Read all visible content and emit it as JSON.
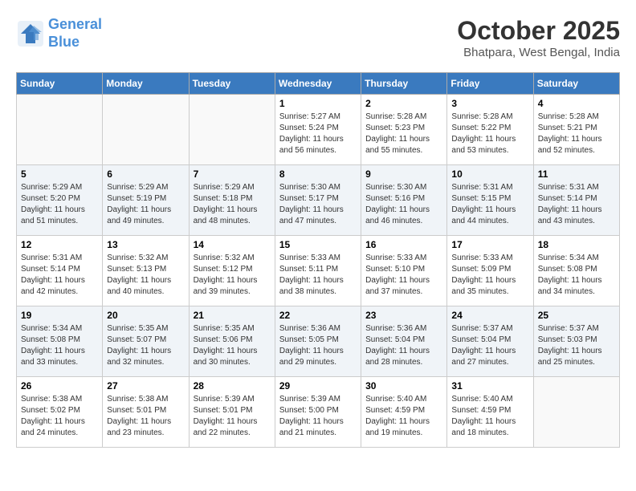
{
  "header": {
    "logo_line1": "General",
    "logo_line2": "Blue",
    "month": "October 2025",
    "location": "Bhatpara, West Bengal, India"
  },
  "days_of_week": [
    "Sunday",
    "Monday",
    "Tuesday",
    "Wednesday",
    "Thursday",
    "Friday",
    "Saturday"
  ],
  "weeks": [
    [
      {
        "day": "",
        "sunrise": "",
        "sunset": "",
        "daylight": ""
      },
      {
        "day": "",
        "sunrise": "",
        "sunset": "",
        "daylight": ""
      },
      {
        "day": "",
        "sunrise": "",
        "sunset": "",
        "daylight": ""
      },
      {
        "day": "1",
        "sunrise": "Sunrise: 5:27 AM",
        "sunset": "Sunset: 5:24 PM",
        "daylight": "Daylight: 11 hours and 56 minutes."
      },
      {
        "day": "2",
        "sunrise": "Sunrise: 5:28 AM",
        "sunset": "Sunset: 5:23 PM",
        "daylight": "Daylight: 11 hours and 55 minutes."
      },
      {
        "day": "3",
        "sunrise": "Sunrise: 5:28 AM",
        "sunset": "Sunset: 5:22 PM",
        "daylight": "Daylight: 11 hours and 53 minutes."
      },
      {
        "day": "4",
        "sunrise": "Sunrise: 5:28 AM",
        "sunset": "Sunset: 5:21 PM",
        "daylight": "Daylight: 11 hours and 52 minutes."
      }
    ],
    [
      {
        "day": "5",
        "sunrise": "Sunrise: 5:29 AM",
        "sunset": "Sunset: 5:20 PM",
        "daylight": "Daylight: 11 hours and 51 minutes."
      },
      {
        "day": "6",
        "sunrise": "Sunrise: 5:29 AM",
        "sunset": "Sunset: 5:19 PM",
        "daylight": "Daylight: 11 hours and 49 minutes."
      },
      {
        "day": "7",
        "sunrise": "Sunrise: 5:29 AM",
        "sunset": "Sunset: 5:18 PM",
        "daylight": "Daylight: 11 hours and 48 minutes."
      },
      {
        "day": "8",
        "sunrise": "Sunrise: 5:30 AM",
        "sunset": "Sunset: 5:17 PM",
        "daylight": "Daylight: 11 hours and 47 minutes."
      },
      {
        "day": "9",
        "sunrise": "Sunrise: 5:30 AM",
        "sunset": "Sunset: 5:16 PM",
        "daylight": "Daylight: 11 hours and 46 minutes."
      },
      {
        "day": "10",
        "sunrise": "Sunrise: 5:31 AM",
        "sunset": "Sunset: 5:15 PM",
        "daylight": "Daylight: 11 hours and 44 minutes."
      },
      {
        "day": "11",
        "sunrise": "Sunrise: 5:31 AM",
        "sunset": "Sunset: 5:14 PM",
        "daylight": "Daylight: 11 hours and 43 minutes."
      }
    ],
    [
      {
        "day": "12",
        "sunrise": "Sunrise: 5:31 AM",
        "sunset": "Sunset: 5:14 PM",
        "daylight": "Daylight: 11 hours and 42 minutes."
      },
      {
        "day": "13",
        "sunrise": "Sunrise: 5:32 AM",
        "sunset": "Sunset: 5:13 PM",
        "daylight": "Daylight: 11 hours and 40 minutes."
      },
      {
        "day": "14",
        "sunrise": "Sunrise: 5:32 AM",
        "sunset": "Sunset: 5:12 PM",
        "daylight": "Daylight: 11 hours and 39 minutes."
      },
      {
        "day": "15",
        "sunrise": "Sunrise: 5:33 AM",
        "sunset": "Sunset: 5:11 PM",
        "daylight": "Daylight: 11 hours and 38 minutes."
      },
      {
        "day": "16",
        "sunrise": "Sunrise: 5:33 AM",
        "sunset": "Sunset: 5:10 PM",
        "daylight": "Daylight: 11 hours and 37 minutes."
      },
      {
        "day": "17",
        "sunrise": "Sunrise: 5:33 AM",
        "sunset": "Sunset: 5:09 PM",
        "daylight": "Daylight: 11 hours and 35 minutes."
      },
      {
        "day": "18",
        "sunrise": "Sunrise: 5:34 AM",
        "sunset": "Sunset: 5:08 PM",
        "daylight": "Daylight: 11 hours and 34 minutes."
      }
    ],
    [
      {
        "day": "19",
        "sunrise": "Sunrise: 5:34 AM",
        "sunset": "Sunset: 5:08 PM",
        "daylight": "Daylight: 11 hours and 33 minutes."
      },
      {
        "day": "20",
        "sunrise": "Sunrise: 5:35 AM",
        "sunset": "Sunset: 5:07 PM",
        "daylight": "Daylight: 11 hours and 32 minutes."
      },
      {
        "day": "21",
        "sunrise": "Sunrise: 5:35 AM",
        "sunset": "Sunset: 5:06 PM",
        "daylight": "Daylight: 11 hours and 30 minutes."
      },
      {
        "day": "22",
        "sunrise": "Sunrise: 5:36 AM",
        "sunset": "Sunset: 5:05 PM",
        "daylight": "Daylight: 11 hours and 29 minutes."
      },
      {
        "day": "23",
        "sunrise": "Sunrise: 5:36 AM",
        "sunset": "Sunset: 5:04 PM",
        "daylight": "Daylight: 11 hours and 28 minutes."
      },
      {
        "day": "24",
        "sunrise": "Sunrise: 5:37 AM",
        "sunset": "Sunset: 5:04 PM",
        "daylight": "Daylight: 11 hours and 27 minutes."
      },
      {
        "day": "25",
        "sunrise": "Sunrise: 5:37 AM",
        "sunset": "Sunset: 5:03 PM",
        "daylight": "Daylight: 11 hours and 25 minutes."
      }
    ],
    [
      {
        "day": "26",
        "sunrise": "Sunrise: 5:38 AM",
        "sunset": "Sunset: 5:02 PM",
        "daylight": "Daylight: 11 hours and 24 minutes."
      },
      {
        "day": "27",
        "sunrise": "Sunrise: 5:38 AM",
        "sunset": "Sunset: 5:01 PM",
        "daylight": "Daylight: 11 hours and 23 minutes."
      },
      {
        "day": "28",
        "sunrise": "Sunrise: 5:39 AM",
        "sunset": "Sunset: 5:01 PM",
        "daylight": "Daylight: 11 hours and 22 minutes."
      },
      {
        "day": "29",
        "sunrise": "Sunrise: 5:39 AM",
        "sunset": "Sunset: 5:00 PM",
        "daylight": "Daylight: 11 hours and 21 minutes."
      },
      {
        "day": "30",
        "sunrise": "Sunrise: 5:40 AM",
        "sunset": "Sunset: 4:59 PM",
        "daylight": "Daylight: 11 hours and 19 minutes."
      },
      {
        "day": "31",
        "sunrise": "Sunrise: 5:40 AM",
        "sunset": "Sunset: 4:59 PM",
        "daylight": "Daylight: 11 hours and 18 minutes."
      },
      {
        "day": "",
        "sunrise": "",
        "sunset": "",
        "daylight": ""
      }
    ]
  ]
}
